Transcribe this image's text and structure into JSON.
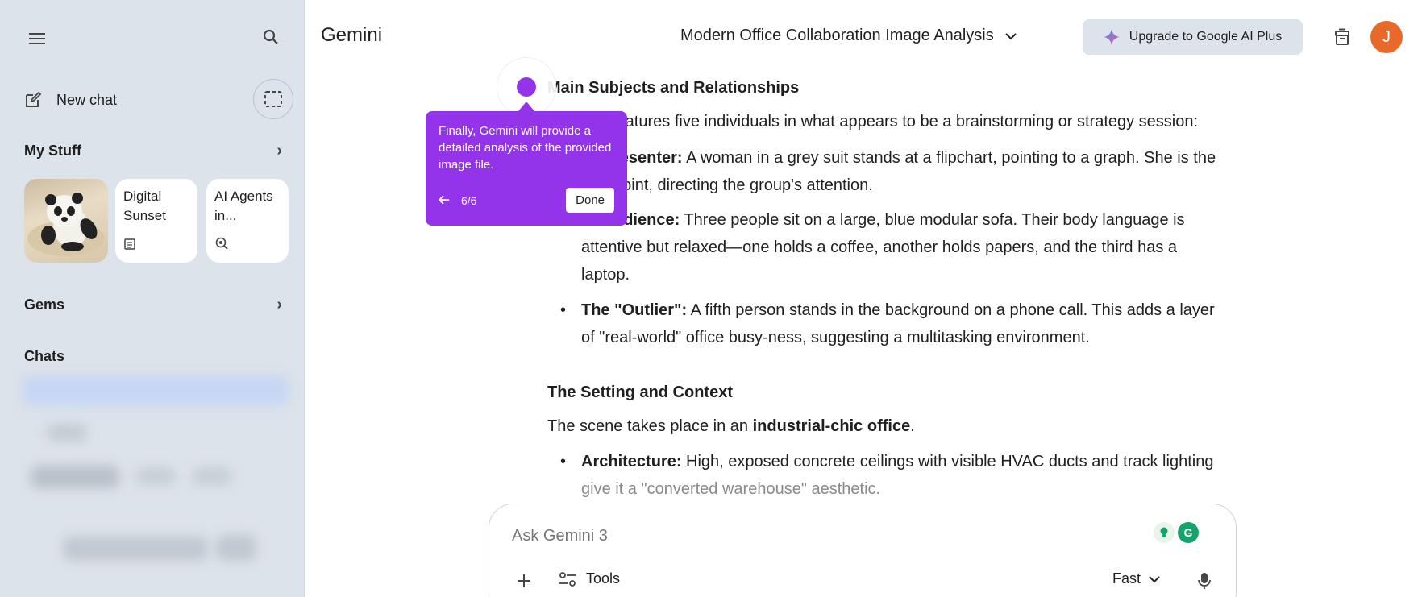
{
  "sidebar": {
    "new_chat_label": "New chat",
    "my_stuff_label": "My Stuff",
    "cards": [
      {
        "title": "Digital Sunset",
        "icon": "document-icon"
      },
      {
        "title": "AI Agents in...",
        "icon": "deep-research-icon"
      }
    ],
    "gems_label": "Gems",
    "chats_label": "Chats"
  },
  "header": {
    "brand": "Gemini",
    "conversation_title": "Modern Office Collaboration Image Analysis",
    "upgrade_label": "Upgrade to Google AI Plus",
    "avatar_initial": "J"
  },
  "content": {
    "heading1": "Main Subjects and Relationships",
    "intro": "features five individuals in what appears to be a brainstorming or strategy session:",
    "bullets1": [
      {
        "bold": "resenter:",
        "text": " A woman in a grey suit stands at a flipchart, pointing to a graph. She is the",
        "cont": "point, directing the group's attention."
      },
      {
        "bold": "udience:",
        "text": " Three people sit on a large, blue modular sofa. Their body language is",
        "cont": "attentive but relaxed—one holds a coffee, another holds papers, and the third has a",
        "cont2": "laptop."
      },
      {
        "bold": "The \"Outlier\":",
        "text": " A fifth person stands in the background on a phone call. This adds a layer",
        "cont": "of \"real-world\" office busy-ness, suggesting a multitasking environment."
      }
    ],
    "heading2": "The Setting and Context",
    "setting_pre": "The scene takes place in an ",
    "setting_bold": "industrial-chic office",
    "setting_post": ".",
    "bullets2": [
      {
        "bold": "Architecture:",
        "text": " High, exposed concrete ceilings with visible HVAC ducts and track lighting",
        "cont": "give it a \"converted warehouse\" aesthetic."
      }
    ]
  },
  "tooltip": {
    "text": "Finally, Gemini will provide a detailed analysis of the provided image file.",
    "step": "6/6",
    "done_label": "Done"
  },
  "composer": {
    "placeholder": "Ask Gemini 3",
    "tools_label": "Tools",
    "mode_label": "Fast"
  },
  "colors": {
    "sidebar_bg": "#dde3ea",
    "accent_purple": "#9333ea",
    "avatar_orange": "#e8692a"
  }
}
